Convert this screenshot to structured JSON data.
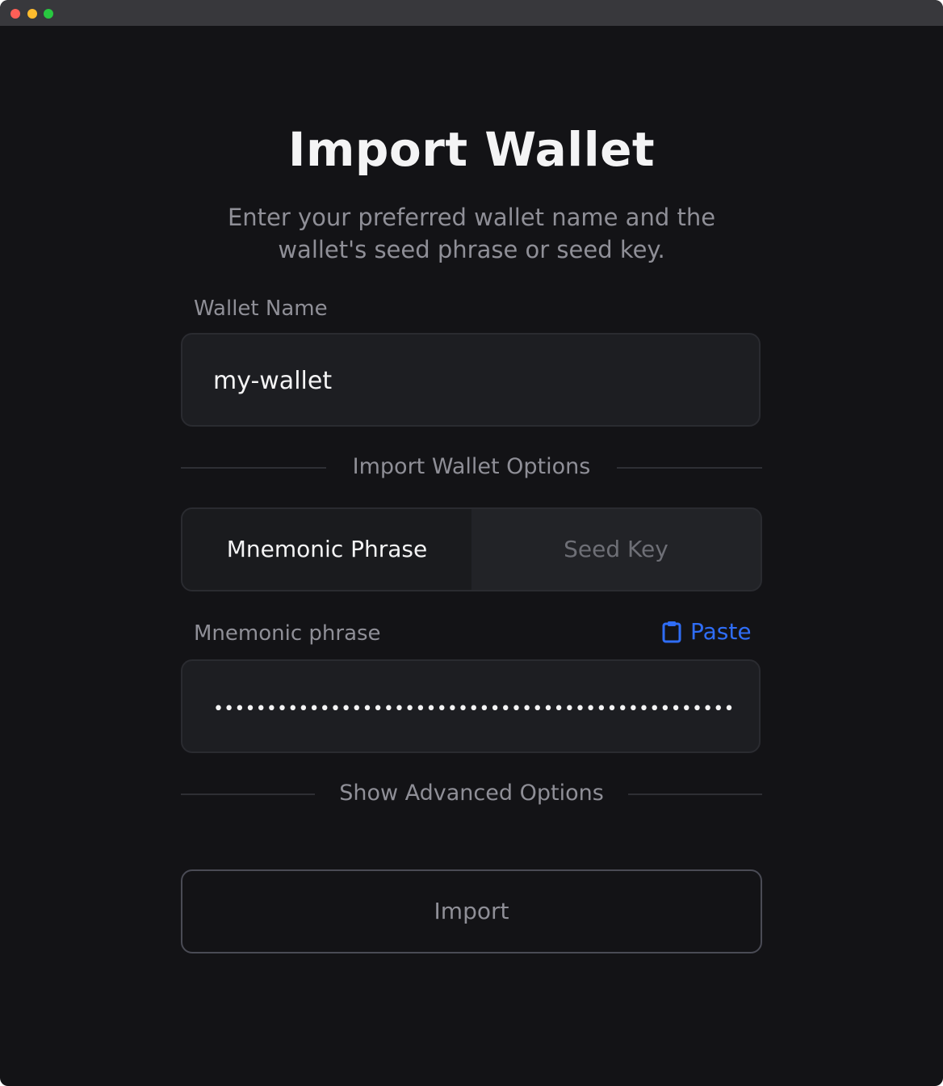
{
  "window": {
    "controls": [
      "close",
      "minimize",
      "maximize"
    ]
  },
  "page": {
    "title": "Import Wallet",
    "subtitle_line1": "Enter your preferred wallet name and the",
    "subtitle_line2": "wallet's seed phrase or seed key."
  },
  "wallet_name": {
    "label": "Wallet Name",
    "value": "my-wallet"
  },
  "import_options": {
    "divider_label": "Import Wallet Options",
    "tabs": [
      {
        "label": "Mnemonic Phrase",
        "selected": true
      },
      {
        "label": "Seed Key",
        "selected": false
      }
    ]
  },
  "mnemonic": {
    "label": "Mnemonic phrase",
    "paste_label": "Paste",
    "paste_icon": "clipboard-icon",
    "masked_value": "•••••••••••••••••••••••••••••••••••••••••••••••••"
  },
  "advanced": {
    "label": "Show Advanced Options"
  },
  "actions": {
    "import_label": "Import"
  },
  "colors": {
    "background": "#131316",
    "titlebar": "#38383c",
    "field_background": "#1d1e22",
    "accent_blue": "#2f6df6",
    "muted_text": "#8f8f97",
    "primary_text": "#f4f4f5"
  }
}
